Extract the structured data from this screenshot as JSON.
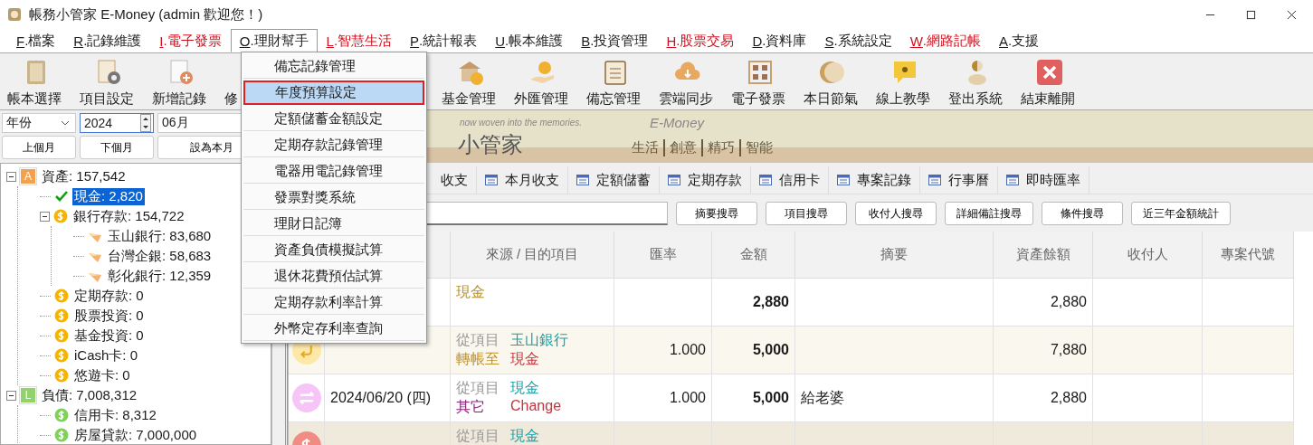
{
  "window": {
    "title": "帳務小管家 E-Money (admin 歡迎您！)"
  },
  "menubar": [
    {
      "key": "F",
      "label": ".檔案",
      "color": "#1a1a1a",
      "selected": false
    },
    {
      "key": "R",
      "label": ".記錄維護",
      "color": "#1a1a1a",
      "selected": false
    },
    {
      "key": "I",
      "label": ".電子發票",
      "color": "#d0101e",
      "selected": false
    },
    {
      "key": "O",
      "label": ".理財幫手",
      "color": "#1a1a1a",
      "selected": true
    },
    {
      "key": "L",
      "label": ".智慧生活",
      "color": "#d0101e",
      "selected": false
    },
    {
      "key": "P",
      "label": ".統計報表",
      "color": "#1a1a1a",
      "selected": false
    },
    {
      "key": "U",
      "label": ".帳本維護",
      "color": "#1a1a1a",
      "selected": false
    },
    {
      "key": "B",
      "label": ".投資管理",
      "color": "#1a1a1a",
      "selected": false
    },
    {
      "key": "H",
      "label": ".股票交易",
      "color": "#d0101e",
      "selected": false
    },
    {
      "key": "D",
      "label": ".資料庫",
      "color": "#1a1a1a",
      "selected": false
    },
    {
      "key": "S",
      "label": ".系統設定",
      "color": "#1a1a1a",
      "selected": false
    },
    {
      "key": "W",
      "label": ".網路記帳",
      "color": "#d0101e",
      "selected": false
    },
    {
      "key": "A",
      "label": ".支援",
      "color": "#1a1a1a",
      "selected": false
    }
  ],
  "open_menu": {
    "items": [
      {
        "label": "備忘記錄管理",
        "selected": false
      },
      {
        "label": "年度預算設定",
        "selected": true
      },
      {
        "label": "定額儲蓄金額設定",
        "selected": false
      },
      {
        "label": "定期存款記錄管理",
        "selected": false
      },
      {
        "label": "電器用電記錄管理",
        "selected": false
      },
      {
        "label": "發票對獎系統",
        "selected": false
      },
      {
        "label": "理財日記簿",
        "selected": false
      },
      {
        "label": "資產負債模擬試算",
        "selected": false
      },
      {
        "label": "退休花費預估試算",
        "selected": false
      },
      {
        "label": "定期存款利率計算",
        "selected": false
      },
      {
        "label": "外幣定存利率查詢",
        "selected": false
      }
    ]
  },
  "toolbar": [
    "帳本選擇",
    "項目設定",
    "新增記錄",
    "修",
    "基金管理",
    "外匯管理",
    "備忘管理",
    "雲端同步",
    "電子發票",
    "本日節氣",
    "線上教學",
    "登出系統",
    "結束離開"
  ],
  "period": {
    "unit": "年份",
    "year": "2024",
    "month": "06月"
  },
  "nav_buttons": [
    "上個月",
    "下個月",
    "設為本月"
  ],
  "tree": [
    {
      "label": "資產: 157,542",
      "kind": "group",
      "badge": "A",
      "color": "#f5a04a",
      "selected": false,
      "expanded": true,
      "children": [
        {
          "label": "現金: 2,820",
          "kind": "check",
          "selected": true
        },
        {
          "label": "銀行存款: 154,722",
          "kind": "coin",
          "color": "#f4b400",
          "selected": false,
          "expanded": true,
          "children": [
            {
              "label": "玉山銀行: 83,680",
              "kind": "wedge",
              "selected": false
            },
            {
              "label": "台灣企銀: 58,683",
              "kind": "wedge",
              "selected": false
            },
            {
              "label": "彰化銀行: 12,359",
              "kind": "wedge",
              "selected": false
            }
          ]
        },
        {
          "label": "定期存款: 0",
          "kind": "coin",
          "color": "#f4b400",
          "selected": false
        },
        {
          "label": "股票投資: 0",
          "kind": "coin",
          "color": "#f4b400",
          "selected": false
        },
        {
          "label": "基金投資: 0",
          "kind": "coin",
          "color": "#f4b400",
          "selected": false
        },
        {
          "label": "iCash卡: 0",
          "kind": "coin",
          "color": "#f4b400",
          "selected": false
        },
        {
          "label": "悠遊卡: 0",
          "kind": "coin",
          "color": "#f4b400",
          "selected": false
        }
      ]
    },
    {
      "label": "負債: 7,008,312",
      "kind": "group",
      "badge": "L",
      "color": "#8fd36a",
      "selected": false,
      "expanded": true,
      "children": [
        {
          "label": "信用卡: 8,312",
          "kind": "coin",
          "color": "#7fd15a",
          "selected": false
        },
        {
          "label": "房屋貸款: 7,000,000",
          "kind": "coin",
          "color": "#7fd15a",
          "selected": false
        }
      ]
    }
  ],
  "banner": {
    "tagline": "now woven into the memories.",
    "brand": "E-Money",
    "title": "小管家",
    "slogan": [
      "生活",
      "創意",
      "精巧",
      "智能"
    ]
  },
  "tabs": [
    {
      "label": "收支",
      "selected": false
    },
    {
      "label": "本月收支",
      "selected": false
    },
    {
      "label": "定額儲蓄",
      "selected": false
    },
    {
      "label": "定期存款",
      "selected": false
    },
    {
      "label": "信用卡",
      "selected": false
    },
    {
      "label": "專案記錄",
      "selected": false
    },
    {
      "label": "行事曆",
      "selected": false
    },
    {
      "label": "即時匯率",
      "selected": false
    }
  ],
  "search_buttons": [
    "摘要搜尋",
    "項目搜尋",
    "收付人搜尋",
    "詳細備註搜尋",
    "條件搜尋",
    "近三年金額統計"
  ],
  "table": {
    "columns": [
      "來源 / 目的項目",
      "匯率",
      "金額",
      "摘要",
      "資產餘額",
      "收付人",
      "專案代號"
    ],
    "rows": [
      {
        "source": [
          {
            "parts": [
              {
                "text": "現金",
                "color": "#b8902a"
              }
            ]
          }
        ],
        "amount": "2,880",
        "balance": "2,880"
      },
      {
        "kind": "transfer",
        "source": [
          {
            "parts": [
              {
                "text": "從項目",
                "color": "#9a9a9a"
              },
              {
                "text": "玉山銀行",
                "color": "#17a0a8"
              }
            ]
          },
          {
            "parts": [
              {
                "text": "轉帳至",
                "color": "#c0902a"
              },
              {
                "text": "現金",
                "color": "#c8323c"
              }
            ]
          }
        ],
        "rate": "1.000",
        "amount": "5,000",
        "balance": "7,880"
      },
      {
        "kind": "exchange",
        "date": "2024/06/20 (四)",
        "source": [
          {
            "parts": [
              {
                "text": "從項目",
                "color": "#9a9a9a"
              },
              {
                "text": "現金",
                "color": "#17a0a8"
              }
            ]
          },
          {
            "parts": [
              {
                "text": "其它",
                "color": "#8a1f7a"
              },
              {
                "text": "Change",
                "color": "#c8323c"
              }
            ]
          }
        ],
        "rate": "1.000",
        "amount": "5,000",
        "memo": "給老婆",
        "balance": "2,880"
      },
      {
        "kind": "dollar",
        "source": [
          {
            "parts": [
              {
                "text": "從項目",
                "color": "#9a9a9a"
              },
              {
                "text": "現金",
                "color": "#17a0a8"
              }
            ]
          }
        ]
      }
    ]
  }
}
